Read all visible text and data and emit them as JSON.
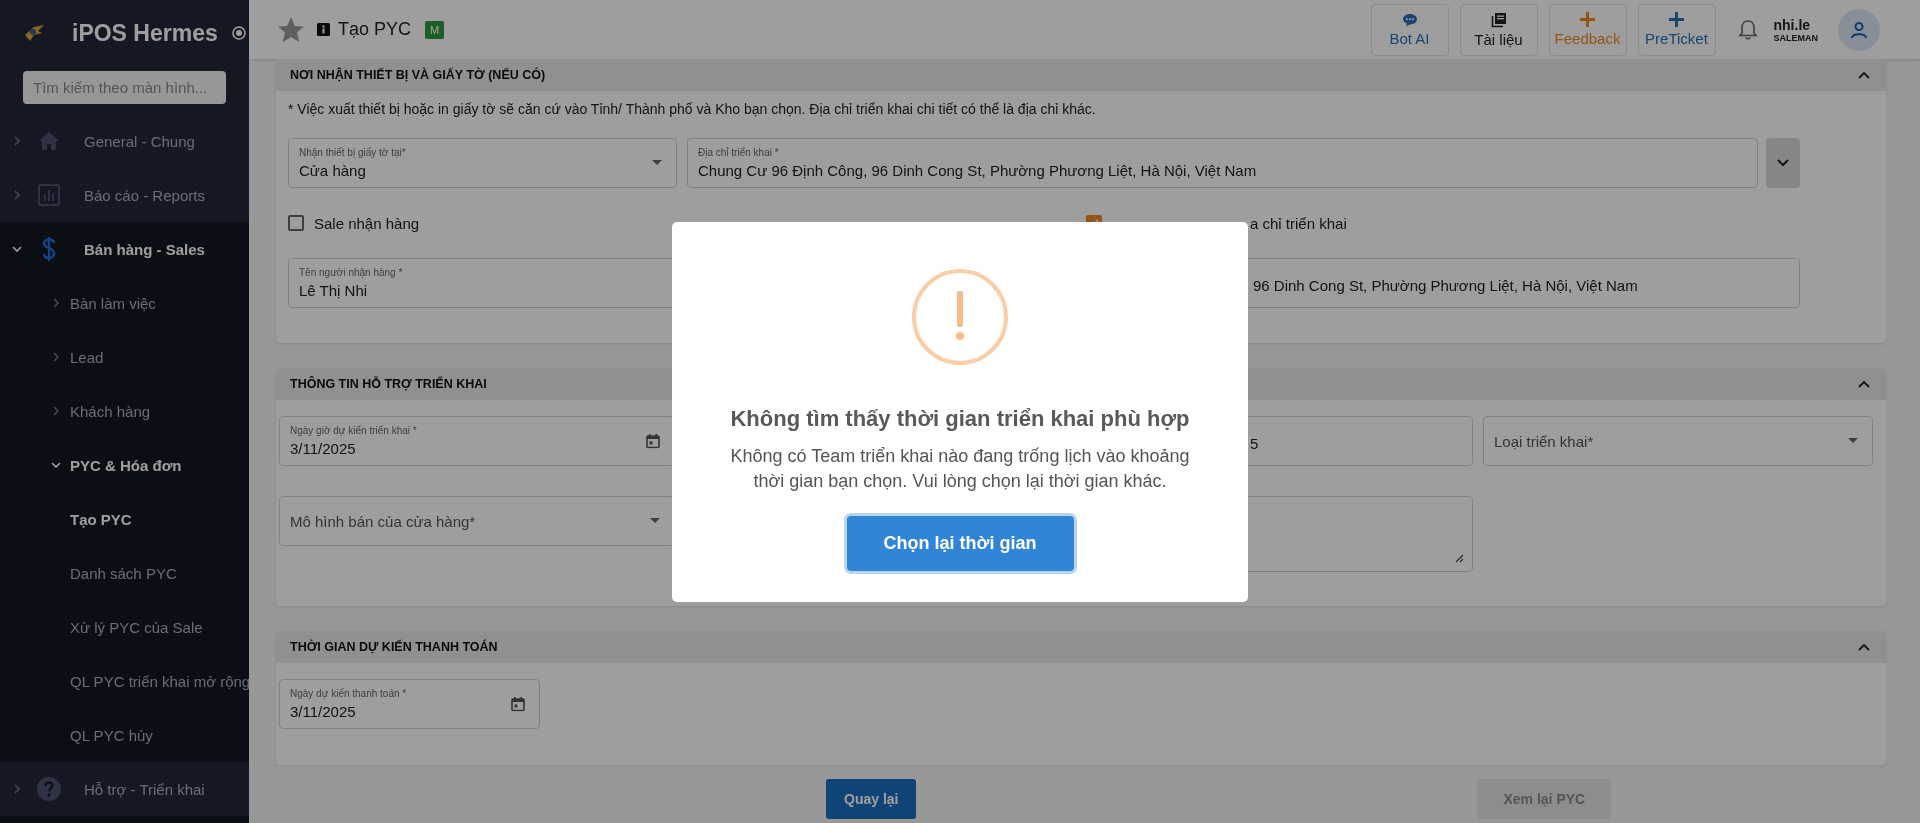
{
  "sidebar": {
    "title": "iPOS Hermes",
    "search": {
      "placeholder": "Tìm kiếm theo màn hình..."
    },
    "items": [
      {
        "label": "General - Chung",
        "expanded": false
      },
      {
        "label": "Báo cáo - Reports",
        "expanded": false
      },
      {
        "label": "Bán hàng - Sales",
        "expanded": true,
        "children": [
          {
            "label": "Bàn làm việc",
            "expanded": false
          },
          {
            "label": "Lead",
            "expanded": false
          },
          {
            "label": "Khách hàng",
            "expanded": false
          },
          {
            "label": "PYC & Hóa đơn",
            "expanded": true,
            "children": [
              {
                "label": "Tạo PYC",
                "selected": true
              },
              {
                "label": "Danh sách PYC",
                "selected": false
              },
              {
                "label": "Xử lý PYC của Sale",
                "selected": false
              },
              {
                "label": "QL PYC triển khai mở rộng",
                "selected": false
              },
              {
                "label": "QL PYC hủy",
                "selected": false
              }
            ]
          }
        ]
      },
      {
        "label": "Hỗ trợ - Triển khai",
        "expanded": false
      }
    ]
  },
  "top_bar": {
    "title": "Tạo PYC",
    "badge": "M",
    "actions": [
      {
        "kind": "chat",
        "label": "Bot AI",
        "color": "#1a4572"
      },
      {
        "kind": "docs",
        "label": "Tài liệu",
        "color": "#151515"
      },
      {
        "kind": "plus",
        "label": "Feedback",
        "color": "#955616"
      },
      {
        "kind": "plus",
        "label": "PreTicket",
        "color": "#1a4572"
      }
    ],
    "user": {
      "name": "nhi.le",
      "role": "SALEMAN"
    }
  },
  "sections": [
    {
      "title": "NƠI NHẬN THIẾT BỊ VÀ GIẤY TỜ (NẾU CÓ)",
      "expanded": true,
      "note": "* Việc xuất thiết bị hoặc in giấy tờ sẽ căn cứ vào Tỉnh/ Thành phố và Kho bạn chọn. Địa chỉ triển khai chi tiết có thể là địa chỉ khác.",
      "fields": [
        {
          "kind": "select",
          "label": "Nhận thiết bị giấy tờ tại*",
          "value": "Cửa hàng"
        },
        {
          "kind": "text",
          "label": "Địa chỉ triển khai *",
          "value": "Chung Cư 96 Định Công, 96 Dinh Cong St, Phường Phương Liệt, Hà Nội, Việt Nam",
          "menu_button": true
        },
        {
          "kind": "text",
          "label": "Tên người nhận hàng *",
          "value": "Lê Thị Nhi"
        },
        {
          "kind": "text",
          "value": "96 Dinh Cong St, Phường Phương Liệt, Hà Nội, Việt Nam"
        }
      ],
      "checkboxes": [
        {
          "label": "Sale nhận hàng",
          "checked": false
        },
        {
          "label": "a chỉ triển khai",
          "checked": true
        }
      ]
    },
    {
      "title": "THÔNG TIN HỖ TRỢ TRIỂN KHAI",
      "expanded": true,
      "fields": [
        {
          "kind": "date",
          "label": "Ngày giờ dự kiến triển khai *",
          "value": "3/11/2025"
        },
        {
          "kind": "text",
          "value": "5"
        },
        {
          "kind": "select",
          "placeholder": "Loại triển khai*"
        },
        {
          "kind": "select",
          "placeholder": "Mô hình bán của cửa hàng*"
        },
        {
          "kind": "textarea"
        }
      ]
    },
    {
      "title": "THỜI GIAN DỰ KIẾN THANH TOÁN",
      "expanded": true,
      "fields": [
        {
          "kind": "date",
          "label": "Ngày dự kiến thanh toán *",
          "value": "3/11/2025"
        }
      ]
    }
  ],
  "buttons": [
    {
      "label": "Quay lại",
      "disabled": false
    },
    {
      "label": "Xem lại PYC",
      "disabled": true
    }
  ],
  "dialog": {
    "title": "Không tìm thấy thời gian triển khai phù hợp",
    "message": "Không có Team triển khai nào đang trống lịch vào khoảng thời gian bạn chọn. Vui lòng chọn lại thời gian khác.",
    "button": "Chọn lại thời gian"
  }
}
